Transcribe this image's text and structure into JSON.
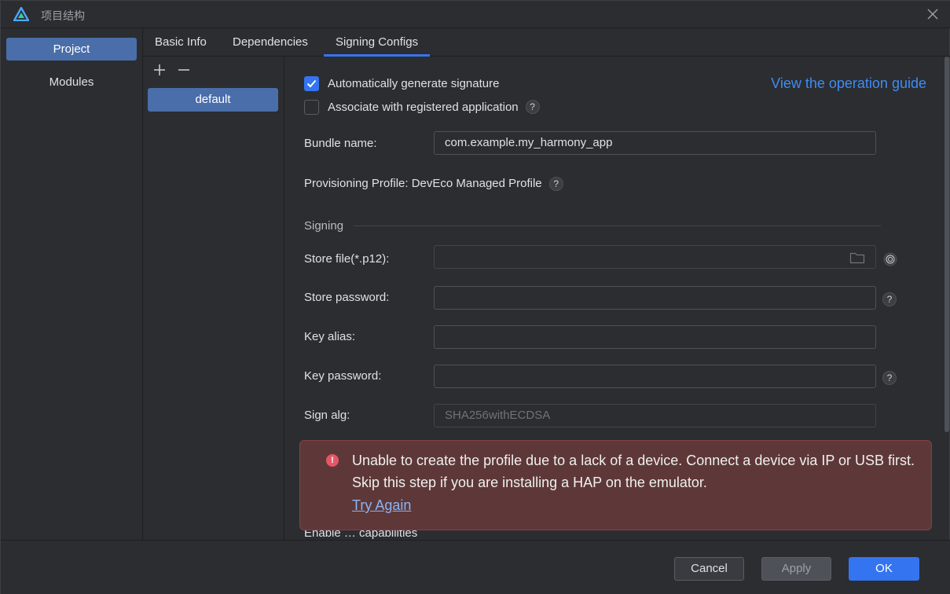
{
  "window": {
    "title": "项目结构"
  },
  "nav": {
    "items": [
      {
        "label": "Project",
        "selected": true
      },
      {
        "label": "Modules",
        "selected": false
      }
    ]
  },
  "tabs": [
    {
      "label": "Basic Info",
      "active": false
    },
    {
      "label": "Dependencies",
      "active": false
    },
    {
      "label": "Signing Configs",
      "active": true
    }
  ],
  "configs": {
    "add_icon": "plus-icon",
    "remove_icon": "minus-icon",
    "items": [
      "default"
    ]
  },
  "signing": {
    "auto_generate": {
      "label": "Automatically generate signature",
      "checked": true
    },
    "associate": {
      "label": "Associate with registered application",
      "checked": false
    },
    "guide_link": "View the operation guide",
    "bundle_name": {
      "label": "Bundle name:",
      "value": "com.example.my_harmony_app"
    },
    "provisioning": "Provisioning Profile: DevEco Managed Profile",
    "section_title": "Signing",
    "store_file": {
      "label": "Store file(*.p12):",
      "value": ""
    },
    "store_password": {
      "label": "Store password:",
      "value": ""
    },
    "key_alias": {
      "label": "Key alias:",
      "value": ""
    },
    "key_password": {
      "label": "Key password:",
      "value": ""
    },
    "sign_alg": {
      "label": "Sign alg:",
      "value": "SHA256withECDSA"
    },
    "partial_label": "Enable … capabilities"
  },
  "error": {
    "message": "Unable to create the profile due to a lack of a device. Connect a device via IP or USB first. Skip this step if you are installing a HAP on the emulator.",
    "retry": "Try Again"
  },
  "footer": {
    "cancel": "Cancel",
    "apply": "Apply",
    "ok": "OK"
  },
  "colors": {
    "accent": "#3574f0",
    "selection": "#4a6ea9",
    "error_bg": "#5e3838",
    "error_icon": "#e55765",
    "link": "#3f8cf5"
  }
}
